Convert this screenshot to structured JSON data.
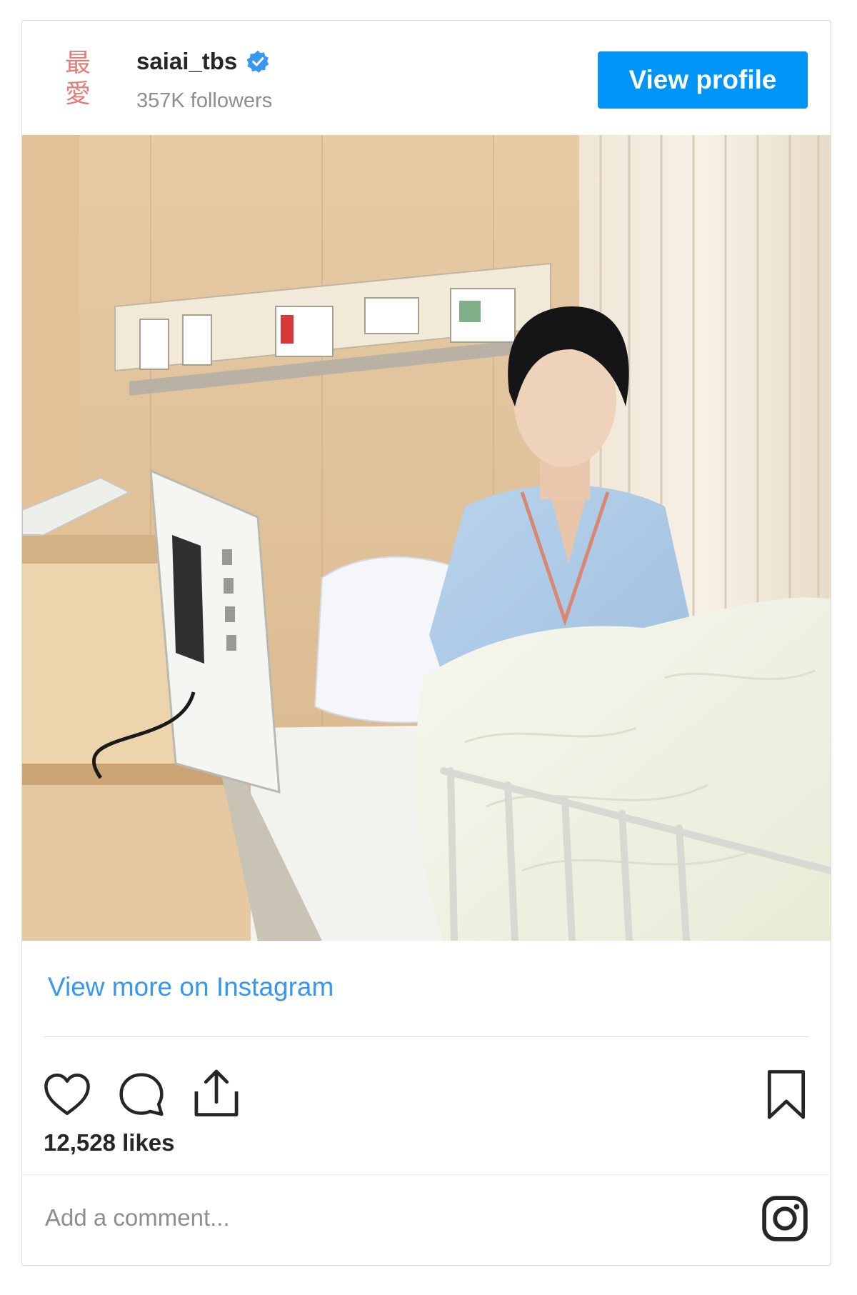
{
  "header": {
    "avatar_text": [
      "最",
      "愛"
    ],
    "username": "saiai_tbs",
    "verified_icon": "verified-badge-icon",
    "followers": "357K followers",
    "view_profile_label": "View profile"
  },
  "post": {
    "view_more_label": "View more on Instagram",
    "likes": "12,528 likes"
  },
  "actions": {
    "icons": [
      "heart-icon",
      "comment-icon",
      "share-icon",
      "bookmark-icon",
      "instagram-logo-icon"
    ]
  },
  "comment": {
    "placeholder": "Add a comment..."
  },
  "colors": {
    "accent": "#0095f6",
    "link": "#3897f0",
    "verified": "#3897f0",
    "text": "#262626",
    "muted": "#8e8e8e",
    "border": "#dbdbdb"
  }
}
